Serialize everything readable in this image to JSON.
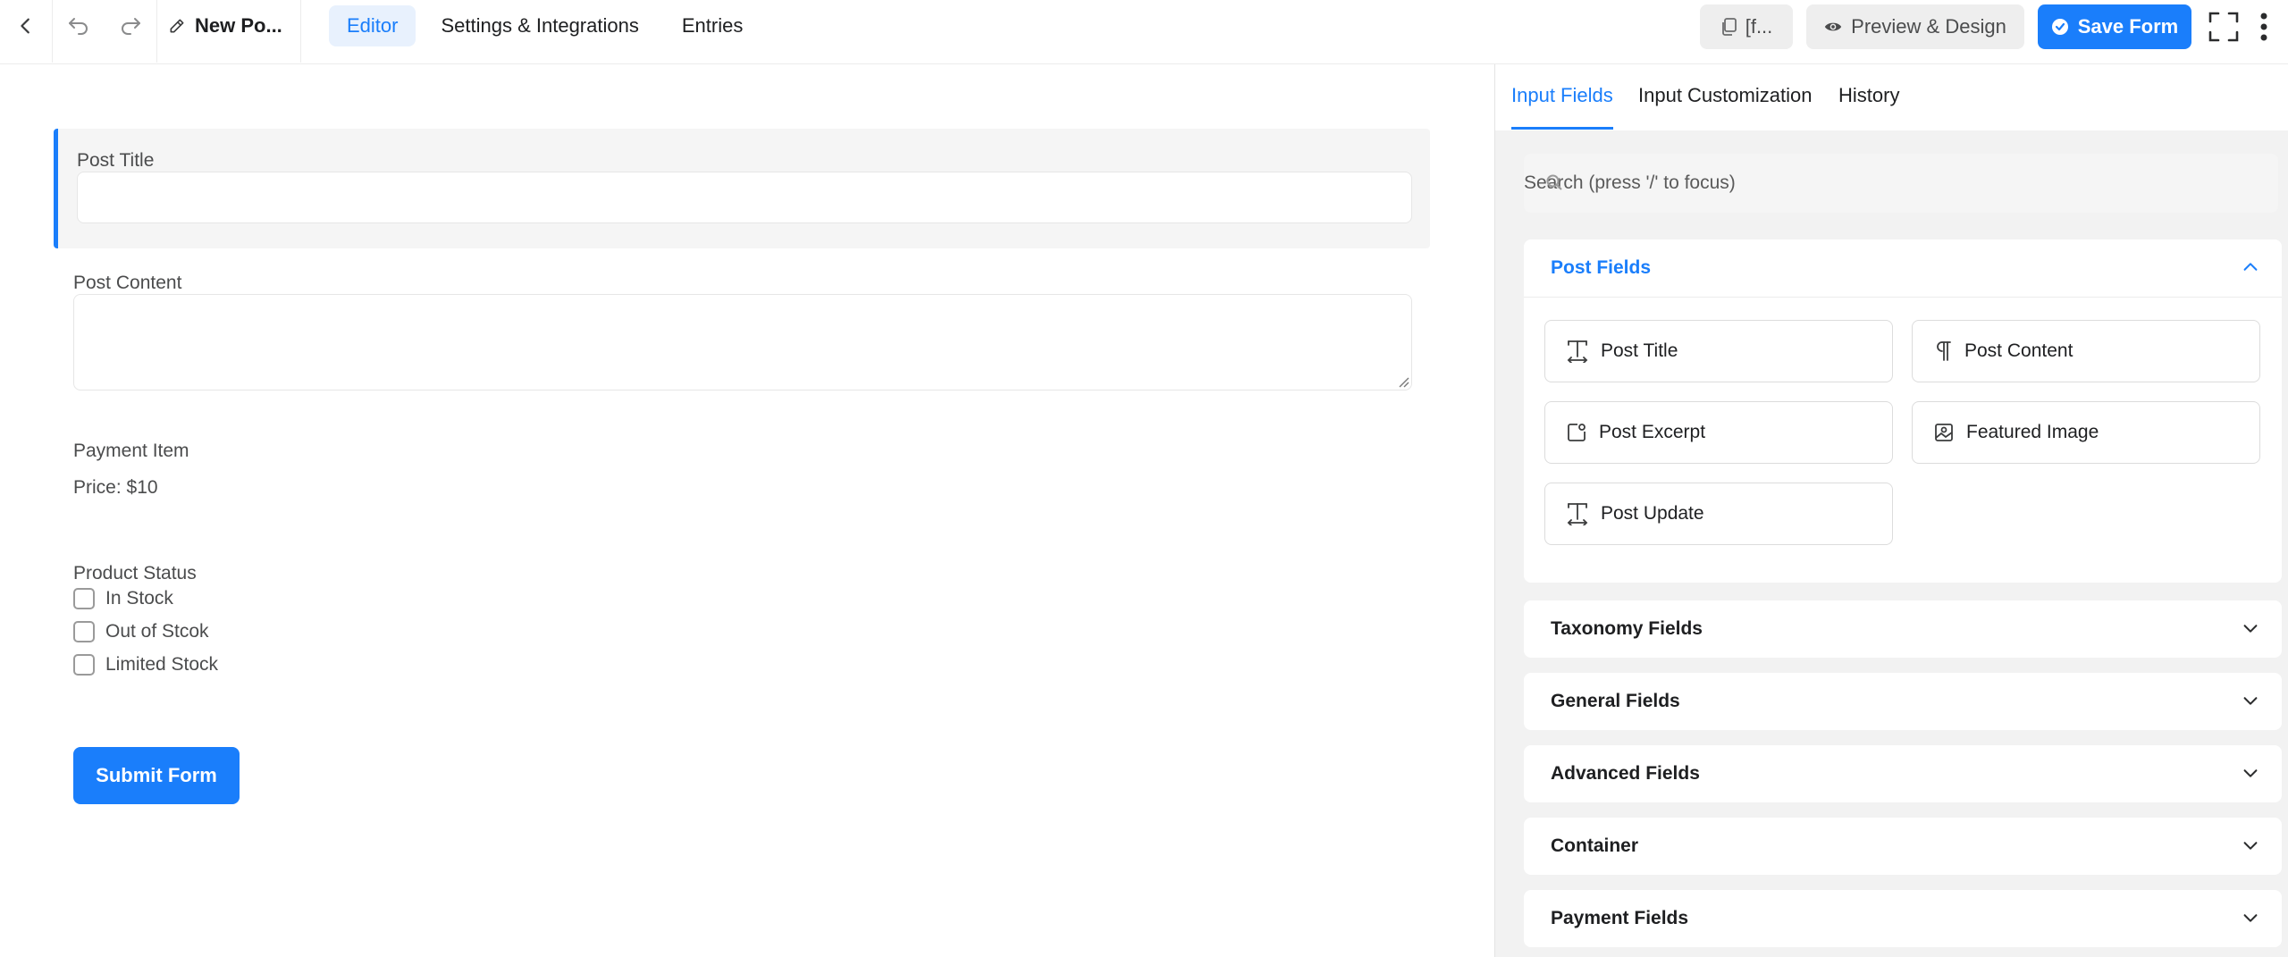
{
  "header": {
    "form_name": "New Po...",
    "nav_tabs": [
      {
        "label": "Editor",
        "active": true
      },
      {
        "label": "Settings & Integrations",
        "active": false
      },
      {
        "label": "Entries",
        "active": false
      }
    ],
    "shortcode_label": "[f...",
    "preview_label": "Preview & Design",
    "save_label": "Save Form"
  },
  "canvas": {
    "post_title_label": "Post Title",
    "post_content_label": "Post Content",
    "payment_item_label": "Payment Item",
    "price_text": "Price: $10",
    "product_status_label": "Product Status",
    "status_options": [
      "In Stock",
      "Out of Stcok",
      "Limited Stock"
    ],
    "submit_label": "Submit Form"
  },
  "sidebar": {
    "tabs": [
      {
        "label": "Input Fields",
        "active": true
      },
      {
        "label": "Input Customization",
        "active": false
      },
      {
        "label": "History",
        "active": false
      }
    ],
    "search_placeholder": "Search (press '/' to focus)",
    "post_fields": {
      "title": "Post Fields",
      "items": [
        {
          "label": "Post Title",
          "icon": "text-cursor-icon"
        },
        {
          "label": "Post Content",
          "icon": "paragraph-icon"
        },
        {
          "label": "Post Excerpt",
          "icon": "excerpt-icon"
        },
        {
          "label": "Featured Image",
          "icon": "image-icon"
        },
        {
          "label": "Post Update",
          "icon": "text-cursor-icon"
        }
      ]
    },
    "collapsed_groups": [
      "Taxonomy Fields",
      "General Fields",
      "Advanced Fields",
      "Container",
      "Payment Fields"
    ]
  },
  "colors": {
    "accent": "#1a7efb",
    "accent_bg": "#e8f1fd",
    "sidebar_bg": "#f2f2f2"
  }
}
